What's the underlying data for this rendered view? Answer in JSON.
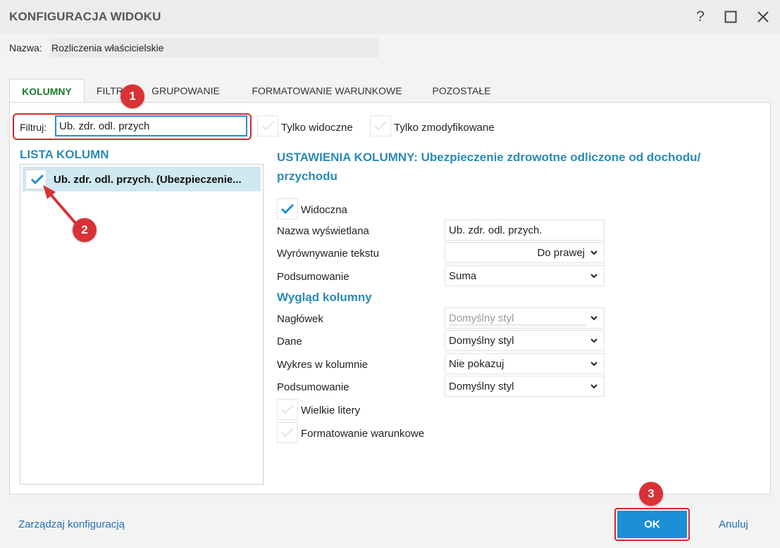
{
  "window": {
    "title": "KONFIGURACJA WIDOKU",
    "help_label": "?",
    "maximize_icon": "maximize-icon",
    "close_icon": "close-icon"
  },
  "name": {
    "label": "Nazwa:",
    "value": "Rozliczenia właścicielskie"
  },
  "tabs": [
    {
      "label": "KOLUMNY",
      "active": true
    },
    {
      "label": "FILTRY",
      "active": false
    },
    {
      "label": "GRUPOWANIE",
      "active": false
    },
    {
      "label": "FORMATOWANIE WARUNKOWE",
      "active": false
    },
    {
      "label": "POZOSTAŁE",
      "active": false
    }
  ],
  "filter": {
    "label": "Filtruj:",
    "value": "Ub. zdr. odl. przych",
    "only_visible_label": "Tylko widoczne",
    "only_visible_checked": false,
    "only_modified_label": "Tylko zmodyfikowane",
    "only_modified_checked": false
  },
  "column_list": {
    "title": "LISTA KOLUMN",
    "items": [
      {
        "label": "Ub. zdr. odl. przych. (Ubezpieczenie...",
        "checked": true
      }
    ]
  },
  "settings": {
    "title": "USTAWIENIA KOLUMNY: Ubezpieczenie zdrowotne odliczone od dochodu/ przychodu",
    "visible_label": "Widoczna",
    "visible_checked": true,
    "display_name_label": "Nazwa wyświetlana",
    "display_name_value": "Ub. zdr. odl. przych.",
    "alignment_label": "Wyrównywanie tekstu",
    "alignment_value": "Do prawej",
    "summary_label": "Podsumowanie",
    "summary_value": "Suma",
    "look_title": "Wygląd kolumny",
    "header_label": "Nagłówek",
    "header_value": "Domyślny styl",
    "data_label": "Dane",
    "data_value": "Domyślny styl",
    "chart_label": "Wykres w kolumnie",
    "chart_value": "Nie pokazuj",
    "summary2_label": "Podsumowanie",
    "summary2_value": "Domyślny styl",
    "uppercase_label": "Wielkie litery",
    "uppercase_checked": false,
    "conditional_label": "Formatowanie warunkowe",
    "conditional_checked": false
  },
  "badges": [
    "1",
    "2",
    "3"
  ],
  "footer": {
    "manage_label": "Zarządzaj konfiguracją",
    "ok_label": "OK",
    "cancel_label": "Anuluj"
  },
  "colors": {
    "accent": "#2a8ab6",
    "active_tab": "#1c7a2e",
    "ok_button": "#1d8fd6",
    "highlight": "#d9262c",
    "badge": "#d93136"
  }
}
